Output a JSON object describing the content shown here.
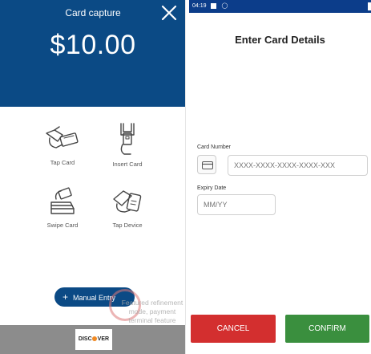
{
  "capture": {
    "title": "Card capture",
    "amount": "$10.00",
    "methods": [
      {
        "label": "Tap Card"
      },
      {
        "label": "Insert Card"
      },
      {
        "label": "Swipe Card"
      },
      {
        "label": "Tap Device"
      }
    ],
    "manual_entry_label": "Manual Entry",
    "overlay_text": "Featured refinement mode, payment terminal feature disabled",
    "card_brand": "DISCOVER",
    "colors": {
      "primary": "#0b4a85",
      "footer": "#8c8c8c"
    }
  },
  "details": {
    "status_time": "04:19",
    "title": "Enter Card Details",
    "card_number_label": "Card Number",
    "card_number_placeholder": "XXXX-XXXX-XXXX-XXXX-XXX",
    "expiry_label": "Expiry Date",
    "expiry_placeholder": "MM/YY",
    "cancel_label": "CANCEL",
    "confirm_label": "CONFIRM",
    "colors": {
      "status_bar": "#0c3d8a",
      "cancel": "#d32f2f",
      "confirm": "#3a8f3e"
    }
  }
}
